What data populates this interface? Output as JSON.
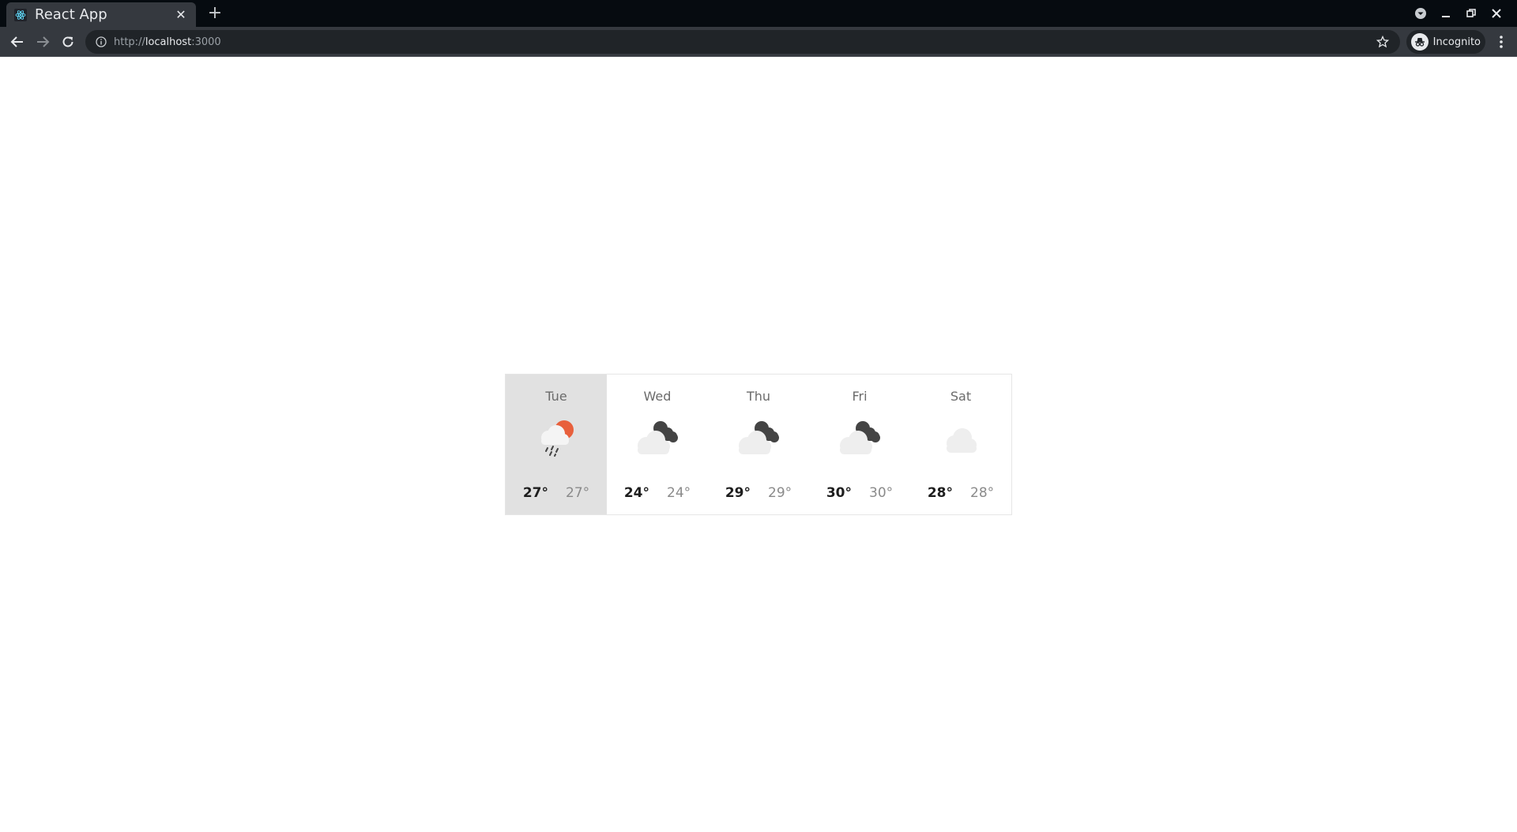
{
  "browser": {
    "tab_title": "React App",
    "url_scheme": "http://",
    "url_host": "localhost",
    "url_port": ":3000",
    "profile_label": "Incognito",
    "theme_colors": {
      "frame": "#060b10",
      "toolbar": "#35393f",
      "omnibox": "#202428",
      "text": "#e8eaed"
    }
  },
  "forecast": {
    "selected_index": 0,
    "days": [
      {
        "name": "Tue",
        "icon": "rain-sun-icon",
        "max": "27°",
        "min": "27°"
      },
      {
        "name": "Wed",
        "icon": "partly-cloudy-night-icon",
        "max": "24°",
        "min": "24°"
      },
      {
        "name": "Thu",
        "icon": "partly-cloudy-night-icon",
        "max": "29°",
        "min": "29°"
      },
      {
        "name": "Fri",
        "icon": "partly-cloudy-night-icon",
        "max": "30°",
        "min": "30°"
      },
      {
        "name": "Sat",
        "icon": "cloud-icon",
        "max": "28°",
        "min": "28°"
      }
    ],
    "colors": {
      "selected_bg": "#e1e1e1",
      "sun": "#e8603c",
      "dark_cloud": "#444444",
      "light_cloud": "#eeeeee"
    }
  }
}
